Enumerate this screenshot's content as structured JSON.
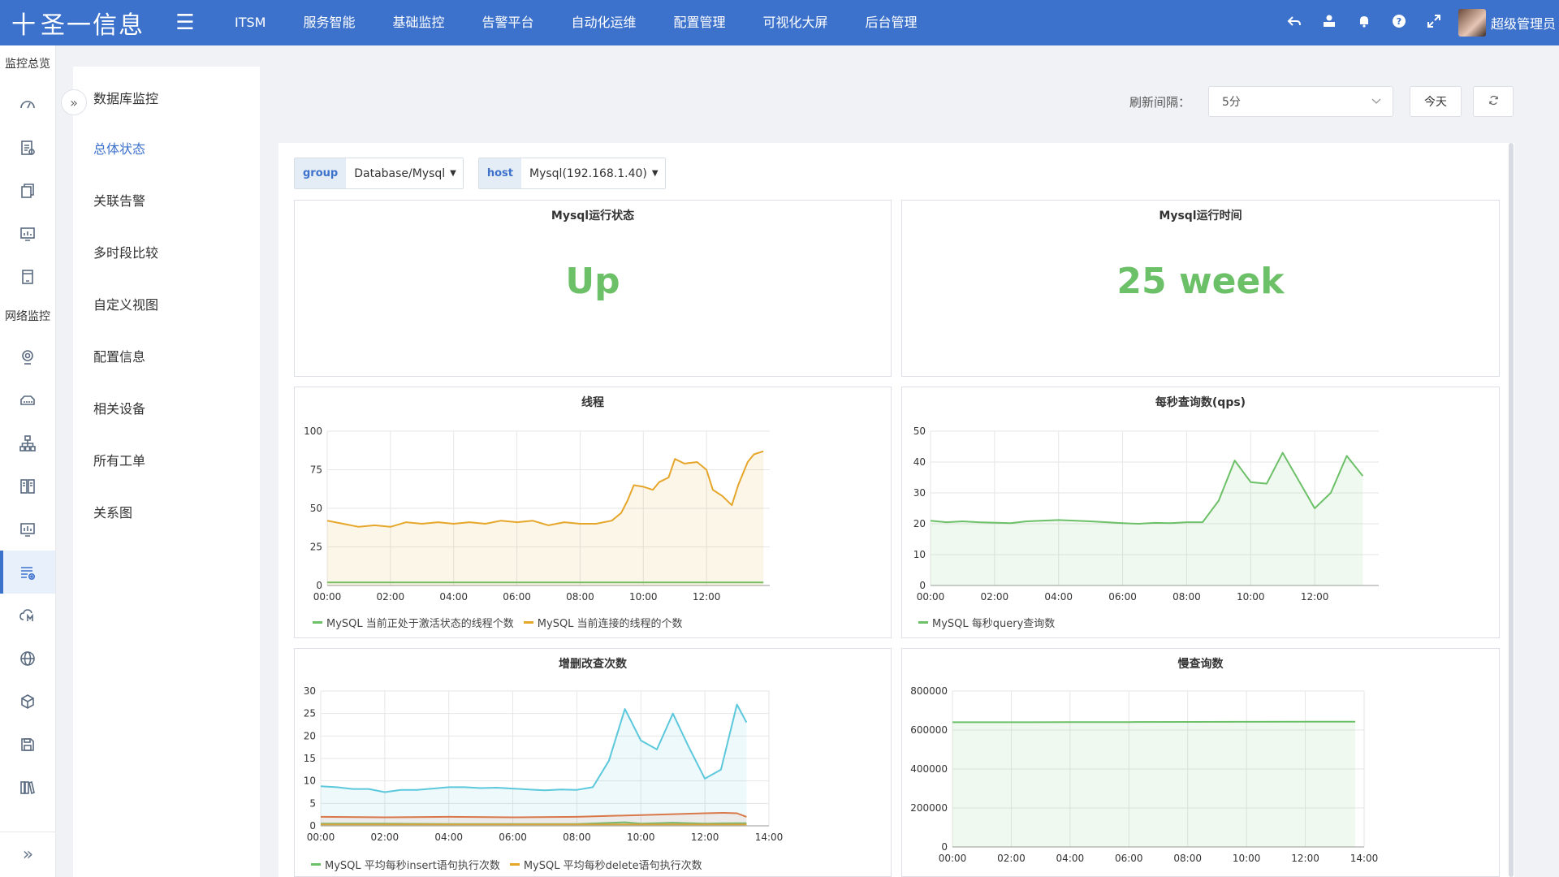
{
  "brand": {
    "name": "圣一信息",
    "mark": "十"
  },
  "nav": [
    "ITSM",
    "服务智能",
    "基础监控",
    "告警平台",
    "自动化运维",
    "配置管理",
    "可视化大屏",
    "后台管理"
  ],
  "user": {
    "name": "超级管理员"
  },
  "sidebar": {
    "section1": "监控总览",
    "section2": "网络监控"
  },
  "submenu": {
    "title": "数据库监控",
    "items": [
      "总体状态",
      "关联告警",
      "多时段比较",
      "自定义视图",
      "配置信息",
      "相关设备",
      "所有工单",
      "关系图"
    ],
    "active_index": 0
  },
  "toolbar": {
    "refresh_label": "刷新间隔：",
    "refresh_value": "5分",
    "today": "今天"
  },
  "filters": [
    {
      "key": "group",
      "value": "Database/Mysql"
    },
    {
      "key": "host",
      "value": "Mysql(192.168.1.40)"
    }
  ],
  "stats": [
    {
      "title": "Mysql运行状态",
      "value": "Up"
    },
    {
      "title": "Mysql运行时间",
      "value": "25 week"
    }
  ],
  "colors": {
    "primary": "#3d72cc",
    "green": "#6cc068",
    "orange": "#e5a62a",
    "cyan": "#5bc8dc",
    "red_orange": "#e8703a"
  },
  "chart_data": [
    {
      "type": "line",
      "title": "线程",
      "x": [
        "00:00",
        "02:00",
        "04:00",
        "06:00",
        "08:00",
        "10:00",
        "12:00"
      ],
      "xticks": [
        "00:00",
        "02:00",
        "04:00",
        "06:00",
        "08:00",
        "10:00",
        "12:00"
      ],
      "xrange": [
        0,
        14
      ],
      "ylim": [
        0,
        100
      ],
      "yticks": [
        0,
        25,
        50,
        75,
        100
      ],
      "series": [
        {
          "name": "MySQL 当前正处于激活状态的线程个数",
          "color": "#6cc068",
          "points": [
            [
              0,
              2
            ],
            [
              2,
              2
            ],
            [
              4,
              2
            ],
            [
              6,
              2
            ],
            [
              8,
              2
            ],
            [
              10,
              2
            ],
            [
              12,
              2
            ],
            [
              13.8,
              2
            ]
          ]
        },
        {
          "name": "MySQL 当前连接的线程的个数",
          "color": "#e5a62a",
          "points": [
            [
              0,
              42
            ],
            [
              0.5,
              40
            ],
            [
              1,
              38
            ],
            [
              1.5,
              39
            ],
            [
              2,
              38
            ],
            [
              2.5,
              41
            ],
            [
              3,
              40
            ],
            [
              3.5,
              41
            ],
            [
              4,
              40
            ],
            [
              4.5,
              41
            ],
            [
              5,
              40
            ],
            [
              5.5,
              42
            ],
            [
              6,
              41
            ],
            [
              6.5,
              42
            ],
            [
              7,
              39
            ],
            [
              7.5,
              41
            ],
            [
              8,
              40
            ],
            [
              8.5,
              40
            ],
            [
              9,
              42
            ],
            [
              9.3,
              47
            ],
            [
              9.5,
              55
            ],
            [
              9.7,
              65
            ],
            [
              10,
              64
            ],
            [
              10.3,
              62
            ],
            [
              10.5,
              67
            ],
            [
              10.8,
              70
            ],
            [
              11,
              82
            ],
            [
              11.3,
              79
            ],
            [
              11.7,
              80
            ],
            [
              12,
              75
            ],
            [
              12.2,
              62
            ],
            [
              12.5,
              58
            ],
            [
              12.8,
              52
            ],
            [
              13,
              65
            ],
            [
              13.3,
              80
            ],
            [
              13.5,
              85
            ],
            [
              13.8,
              87
            ]
          ]
        }
      ]
    },
    {
      "type": "area",
      "title": "每秒查询数(qps)",
      "xticks": [
        "00:00",
        "02:00",
        "04:00",
        "06:00",
        "08:00",
        "10:00",
        "12:00"
      ],
      "xrange": [
        0,
        14
      ],
      "ylim": [
        0,
        50
      ],
      "yticks": [
        0,
        10,
        20,
        30,
        40,
        50
      ],
      "series": [
        {
          "name": "MySQL 每秒query查询数",
          "color": "#6cc068",
          "points": [
            [
              0,
              21
            ],
            [
              0.5,
              20.5
            ],
            [
              1,
              20.8
            ],
            [
              1.5,
              20.5
            ],
            [
              2.5,
              20.2
            ],
            [
              3,
              20.8
            ],
            [
              4,
              21.2
            ],
            [
              5,
              20.8
            ],
            [
              6,
              20.2
            ],
            [
              6.5,
              20
            ],
            [
              7,
              20.3
            ],
            [
              7.5,
              20.2
            ],
            [
              8,
              20.5
            ],
            [
              8.5,
              20.5
            ],
            [
              9,
              27.5
            ],
            [
              9.5,
              40.5
            ],
            [
              10,
              33.5
            ],
            [
              10.5,
              33
            ],
            [
              11,
              43
            ],
            [
              11.5,
              34
            ],
            [
              12,
              25
            ],
            [
              12.5,
              30
            ],
            [
              13,
              42
            ],
            [
              13.5,
              35.5
            ]
          ]
        }
      ]
    },
    {
      "type": "area",
      "title": "增删改查次数",
      "xticks": [
        "00:00",
        "02:00",
        "04:00",
        "06:00",
        "08:00",
        "10:00",
        "12:00",
        "14:00"
      ],
      "xrange": [
        0,
        14
      ],
      "ylim": [
        0,
        30
      ],
      "yticks": [
        0,
        5,
        10,
        15,
        20,
        25,
        30
      ],
      "series": [
        {
          "name": "MySQL 平均每秒insert语句执行次数",
          "color": "#6cc068",
          "points": [
            [
              0,
              0.5
            ],
            [
              2,
              0.5
            ],
            [
              4,
              0.4
            ],
            [
              6,
              0.4
            ],
            [
              8,
              0.4
            ],
            [
              9.5,
              0.8
            ],
            [
              10,
              0.5
            ],
            [
              11,
              0.7
            ],
            [
              12,
              0.5
            ],
            [
              13,
              0.6
            ],
            [
              13.3,
              0.6
            ]
          ]
        },
        {
          "name": "MySQL 平均每秒delete语句执行次数",
          "color": "#e5a62a",
          "points": [
            [
              0,
              0.3
            ],
            [
              2,
              0.3
            ],
            [
              4,
              0.3
            ],
            [
              6,
              0.3
            ],
            [
              8,
              0.3
            ],
            [
              10,
              0.3
            ],
            [
              12,
              0.3
            ],
            [
              13.3,
              0.3
            ]
          ]
        },
        {
          "color": "#e8703a",
          "points": [
            [
              0,
              2
            ],
            [
              2,
              1.9
            ],
            [
              4,
              2
            ],
            [
              6,
              1.9
            ],
            [
              8,
              2
            ],
            [
              9,
              2.2
            ],
            [
              10,
              2.4
            ],
            [
              11,
              2.6
            ],
            [
              12,
              2.8
            ],
            [
              12.6,
              2.9
            ],
            [
              13,
              2.8
            ],
            [
              13.3,
              2
            ]
          ]
        },
        {
          "color": "#5bc8dc",
          "points": [
            [
              0,
              8.8
            ],
            [
              0.5,
              8.6
            ],
            [
              1,
              8.2
            ],
            [
              1.5,
              8.2
            ],
            [
              2,
              7.5
            ],
            [
              2.5,
              8
            ],
            [
              3,
              8
            ],
            [
              3.5,
              8.3
            ],
            [
              4,
              8.6
            ],
            [
              4.5,
              8.6
            ],
            [
              5,
              8.4
            ],
            [
              5.5,
              8.5
            ],
            [
              6,
              8.3
            ],
            [
              6.5,
              8.1
            ],
            [
              7,
              7.9
            ],
            [
              7.5,
              8.1
            ],
            [
              8,
              8
            ],
            [
              8.5,
              8.6
            ],
            [
              9,
              14.5
            ],
            [
              9.5,
              26
            ],
            [
              10,
              19
            ],
            [
              10.5,
              17
            ],
            [
              11,
              25
            ],
            [
              11.5,
              17.5
            ],
            [
              12,
              10.5
            ],
            [
              12.5,
              12.5
            ],
            [
              13,
              27
            ],
            [
              13.3,
              23
            ]
          ]
        }
      ]
    },
    {
      "type": "area",
      "title": "慢查询数",
      "xticks": [
        "00:00",
        "02:00",
        "04:00",
        "06:00",
        "08:00",
        "10:00",
        "12:00",
        "14:00"
      ],
      "xrange": [
        0,
        14
      ],
      "ylim": [
        0,
        800000
      ],
      "yticks": [
        0,
        200000,
        400000,
        600000,
        800000
      ],
      "series": [
        {
          "color": "#6cc068",
          "points": [
            [
              0,
              640000
            ],
            [
              2,
              640000
            ],
            [
              4,
              640500
            ],
            [
              6,
              641000
            ],
            [
              8,
              641500
            ],
            [
              10,
              642000
            ],
            [
              12,
              642500
            ],
            [
              13.7,
              643000
            ]
          ]
        }
      ]
    }
  ]
}
